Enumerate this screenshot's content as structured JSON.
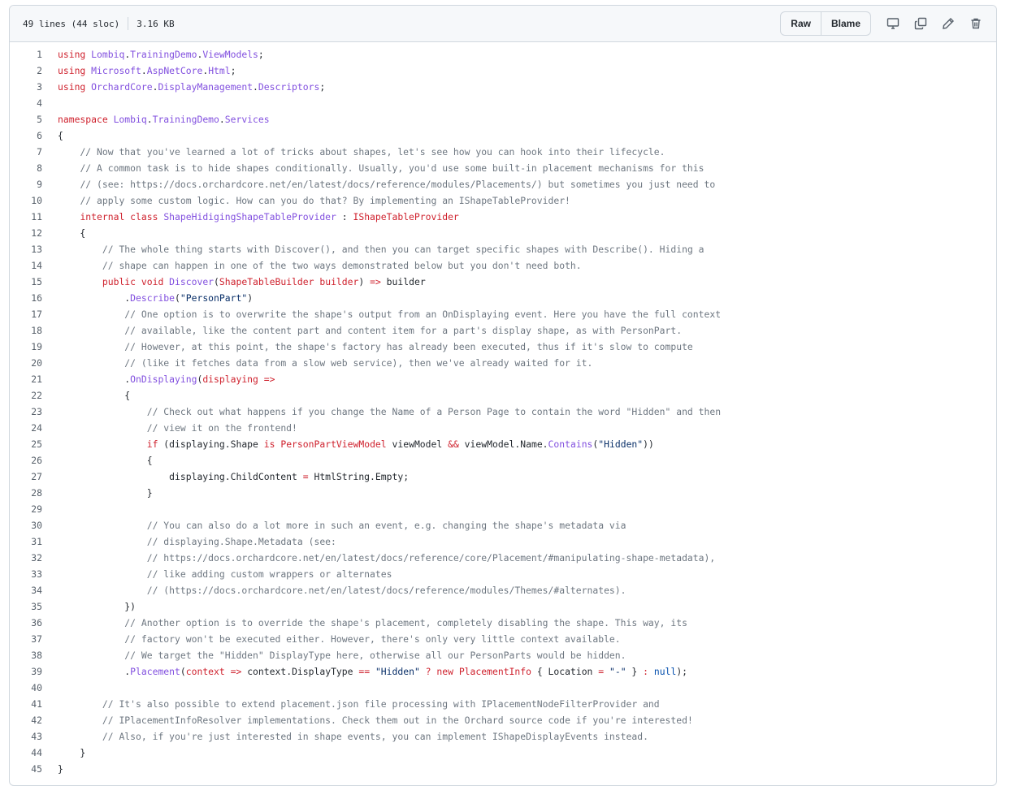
{
  "file_info": {
    "lines": "49 lines (44 sloc)",
    "size": "3.16 KB"
  },
  "toolbar": {
    "raw_label": "Raw",
    "blame_label": "Blame",
    "icons": [
      "desktop-icon",
      "copy-icon",
      "pencil-icon",
      "trash-icon"
    ]
  },
  "colors": {
    "keyword": "#cf222e",
    "entity": "#8250df",
    "comment": "#6e7781",
    "string": "#0a3069",
    "constant": "#0550ae"
  },
  "lines": [
    {
      "n": "1",
      "t": [
        [
          "k",
          "using "
        ],
        [
          "n",
          "Lombiq"
        ],
        [
          "",
          "."
        ],
        [
          "n",
          "TrainingDemo"
        ],
        [
          "",
          "."
        ],
        [
          "n",
          "ViewModels"
        ],
        [
          "",
          ";"
        ]
      ]
    },
    {
      "n": "2",
      "t": [
        [
          "k",
          "using "
        ],
        [
          "n",
          "Microsoft"
        ],
        [
          "",
          "."
        ],
        [
          "n",
          "AspNetCore"
        ],
        [
          "",
          "."
        ],
        [
          "n",
          "Html"
        ],
        [
          "",
          ";"
        ]
      ]
    },
    {
      "n": "3",
      "t": [
        [
          "k",
          "using "
        ],
        [
          "n",
          "OrchardCore"
        ],
        [
          "",
          "."
        ],
        [
          "n",
          "DisplayManagement"
        ],
        [
          "",
          "."
        ],
        [
          "n",
          "Descriptors"
        ],
        [
          "",
          ";"
        ]
      ]
    },
    {
      "n": "4",
      "t": []
    },
    {
      "n": "5",
      "t": [
        [
          "k",
          "namespace "
        ],
        [
          "n",
          "Lombiq"
        ],
        [
          "",
          "."
        ],
        [
          "n",
          "TrainingDemo"
        ],
        [
          "",
          "."
        ],
        [
          "n",
          "Services"
        ]
      ]
    },
    {
      "n": "6",
      "t": [
        [
          "",
          "{"
        ]
      ]
    },
    {
      "n": "7",
      "t": [
        [
          "",
          "    "
        ],
        [
          "c",
          "// Now that you've learned a lot of tricks about shapes, let's see how you can hook into their lifecycle."
        ]
      ]
    },
    {
      "n": "8",
      "t": [
        [
          "",
          "    "
        ],
        [
          "c",
          "// A common task is to hide shapes conditionally. Usually, you'd use some built-in placement mechanisms for this"
        ]
      ]
    },
    {
      "n": "9",
      "t": [
        [
          "",
          "    "
        ],
        [
          "c",
          "// (see: https://docs.orchardcore.net/en/latest/docs/reference/modules/Placements/) but sometimes you just need to"
        ]
      ]
    },
    {
      "n": "10",
      "t": [
        [
          "",
          "    "
        ],
        [
          "c",
          "// apply some custom logic. How can you do that? By implementing an IShapeTableProvider!"
        ]
      ]
    },
    {
      "n": "11",
      "t": [
        [
          "",
          "    "
        ],
        [
          "k",
          "internal class "
        ],
        [
          "n",
          "ShapeHidigingShapeTableProvider"
        ],
        [
          "",
          " : "
        ],
        [
          "k",
          "IShapeTableProvider"
        ]
      ]
    },
    {
      "n": "12",
      "t": [
        [
          "",
          "    {"
        ]
      ]
    },
    {
      "n": "13",
      "t": [
        [
          "",
          "        "
        ],
        [
          "c",
          "// The whole thing starts with Discover(), and then you can target specific shapes with Describe(). Hiding a"
        ]
      ]
    },
    {
      "n": "14",
      "t": [
        [
          "",
          "        "
        ],
        [
          "c",
          "// shape can happen in one of the two ways demonstrated below but you don't need both."
        ]
      ]
    },
    {
      "n": "15",
      "t": [
        [
          "",
          "        "
        ],
        [
          "k",
          "public void "
        ],
        [
          "n",
          "Discover"
        ],
        [
          "",
          "("
        ],
        [
          "k",
          "ShapeTableBuilder "
        ],
        [
          "k",
          "builder"
        ],
        [
          "",
          ") "
        ],
        [
          "k",
          "=>"
        ],
        [
          "",
          " builder"
        ]
      ]
    },
    {
      "n": "16",
      "t": [
        [
          "",
          "            ."
        ],
        [
          "n",
          "Describe"
        ],
        [
          "",
          "("
        ],
        [
          "s",
          "\"PersonPart\""
        ],
        [
          "",
          ")"
        ]
      ]
    },
    {
      "n": "17",
      "t": [
        [
          "",
          "            "
        ],
        [
          "c",
          "// One option is to overwrite the shape's output from an OnDisplaying event. Here you have the full context"
        ]
      ]
    },
    {
      "n": "18",
      "t": [
        [
          "",
          "            "
        ],
        [
          "c",
          "// available, like the content part and content item for a part's display shape, as with PersonPart."
        ]
      ]
    },
    {
      "n": "19",
      "t": [
        [
          "",
          "            "
        ],
        [
          "c",
          "// However, at this point, the shape's factory has already been executed, thus if it's slow to compute"
        ]
      ]
    },
    {
      "n": "20",
      "t": [
        [
          "",
          "            "
        ],
        [
          "c",
          "// (like it fetches data from a slow web service), then we've already waited for it."
        ]
      ]
    },
    {
      "n": "21",
      "t": [
        [
          "",
          "            ."
        ],
        [
          "n",
          "OnDisplaying"
        ],
        [
          "",
          "("
        ],
        [
          "k",
          "displaying"
        ],
        [
          "",
          " "
        ],
        [
          "k",
          "=>"
        ]
      ]
    },
    {
      "n": "22",
      "t": [
        [
          "",
          "            {"
        ]
      ]
    },
    {
      "n": "23",
      "t": [
        [
          "",
          "                "
        ],
        [
          "c",
          "// Check out what happens if you change the Name of a Person Page to contain the word \"Hidden\" and then"
        ]
      ]
    },
    {
      "n": "24",
      "t": [
        [
          "",
          "                "
        ],
        [
          "c",
          "// view it on the frontend!"
        ]
      ]
    },
    {
      "n": "25",
      "t": [
        [
          "",
          "                "
        ],
        [
          "k",
          "if"
        ],
        [
          "",
          " (displaying.Shape "
        ],
        [
          "k",
          "is "
        ],
        [
          "k",
          "PersonPartViewModel"
        ],
        [
          "",
          " viewModel "
        ],
        [
          "k",
          "&&"
        ],
        [
          "",
          " viewModel.Name."
        ],
        [
          "n",
          "Contains"
        ],
        [
          "",
          "("
        ],
        [
          "s",
          "\"Hidden\""
        ],
        [
          "",
          "))"
        ]
      ]
    },
    {
      "n": "26",
      "t": [
        [
          "",
          "                {"
        ]
      ]
    },
    {
      "n": "27",
      "t": [
        [
          "",
          "                    displaying.ChildContent "
        ],
        [
          "k",
          "="
        ],
        [
          "",
          " HtmlString.Empty;"
        ]
      ]
    },
    {
      "n": "28",
      "t": [
        [
          "",
          "                }"
        ]
      ]
    },
    {
      "n": "29",
      "t": []
    },
    {
      "n": "30",
      "t": [
        [
          "",
          "                "
        ],
        [
          "c",
          "// You can also do a lot more in such an event, e.g. changing the shape's metadata via"
        ]
      ]
    },
    {
      "n": "31",
      "t": [
        [
          "",
          "                "
        ],
        [
          "c",
          "// displaying.Shape.Metadata (see:"
        ]
      ]
    },
    {
      "n": "32",
      "t": [
        [
          "",
          "                "
        ],
        [
          "c",
          "// https://docs.orchardcore.net/en/latest/docs/reference/core/Placement/#manipulating-shape-metadata),"
        ]
      ]
    },
    {
      "n": "33",
      "t": [
        [
          "",
          "                "
        ],
        [
          "c",
          "// like adding custom wrappers or alternates"
        ]
      ]
    },
    {
      "n": "34",
      "t": [
        [
          "",
          "                "
        ],
        [
          "c",
          "// (https://docs.orchardcore.net/en/latest/docs/reference/modules/Themes/#alternates)."
        ]
      ]
    },
    {
      "n": "35",
      "t": [
        [
          "",
          "            })"
        ]
      ]
    },
    {
      "n": "36",
      "t": [
        [
          "",
          "            "
        ],
        [
          "c",
          "// Another option is to override the shape's placement, completely disabling the shape. This way, its"
        ]
      ]
    },
    {
      "n": "37",
      "t": [
        [
          "",
          "            "
        ],
        [
          "c",
          "// factory won't be executed either. However, there's only very little context available."
        ]
      ]
    },
    {
      "n": "38",
      "t": [
        [
          "",
          "            "
        ],
        [
          "c",
          "// We target the \"Hidden\" DisplayType here, otherwise all our PersonParts would be hidden."
        ]
      ]
    },
    {
      "n": "39",
      "t": [
        [
          "",
          "            ."
        ],
        [
          "n",
          "Placement"
        ],
        [
          "",
          "("
        ],
        [
          "k",
          "context"
        ],
        [
          "",
          " "
        ],
        [
          "k",
          "=>"
        ],
        [
          "",
          " context.DisplayType "
        ],
        [
          "k",
          "=="
        ],
        [
          "",
          " "
        ],
        [
          "s",
          "\"Hidden\""
        ],
        [
          "",
          " "
        ],
        [
          "k",
          "?"
        ],
        [
          "",
          " "
        ],
        [
          "k",
          "new "
        ],
        [
          "k",
          "PlacementInfo"
        ],
        [
          "",
          " { Location "
        ],
        [
          "k",
          "="
        ],
        [
          "",
          " "
        ],
        [
          "s",
          "\"-\""
        ],
        [
          "",
          " } "
        ],
        [
          "k",
          ":"
        ],
        [
          "",
          " "
        ],
        [
          "b",
          "null"
        ],
        [
          "",
          ");"
        ]
      ]
    },
    {
      "n": "40",
      "t": []
    },
    {
      "n": "41",
      "t": [
        [
          "",
          "        "
        ],
        [
          "c",
          "// It's also possible to extend placement.json file processing with IPlacementNodeFilterProvider and"
        ]
      ]
    },
    {
      "n": "42",
      "t": [
        [
          "",
          "        "
        ],
        [
          "c",
          "// IPlacementInfoResolver implementations. Check them out in the Orchard source code if you're interested!"
        ]
      ]
    },
    {
      "n": "43",
      "t": [
        [
          "",
          "        "
        ],
        [
          "c",
          "// Also, if you're just interested in shape events, you can implement IShapeDisplayEvents instead."
        ]
      ]
    },
    {
      "n": "44",
      "t": [
        [
          "",
          "    }"
        ]
      ]
    },
    {
      "n": "45",
      "t": [
        [
          "",
          "}"
        ]
      ]
    }
  ]
}
